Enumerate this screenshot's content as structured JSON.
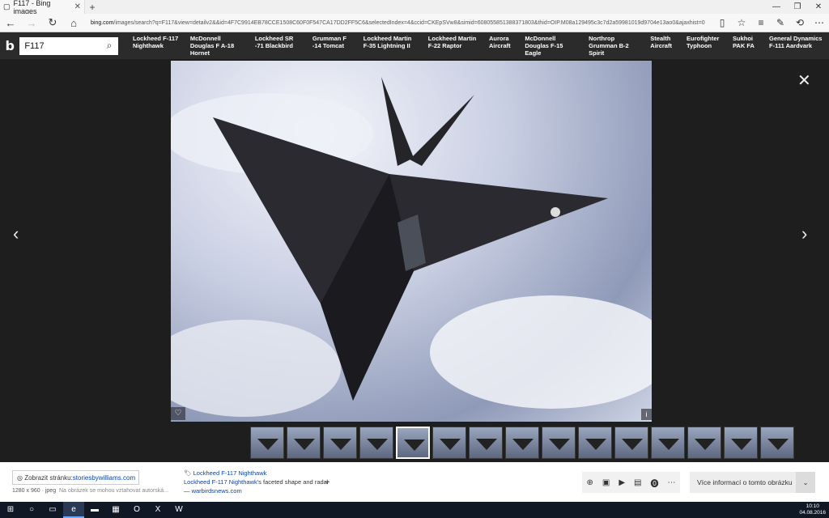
{
  "browser": {
    "tab_title": "F117 - Bing images",
    "url_host": "bing.com",
    "url_rest": "/images/search?q=F117&view=detailv2&&id=4F7C9914EB78CCE1508C60F0F547CA17DD2FF5C6&selectedIndex=4&ccid=CKEpSVw8&simid=608055851388371803&thid=OIP.M08a129495c3c7d2a59981019d9704e13ao0&ajaxhist=0"
  },
  "search": {
    "query": "F117"
  },
  "related": [
    "Lockheed F-117 Nighthawk",
    "McDonnell Douglas F A-18 Hornet",
    "Lockheed SR -71 Blackbird",
    "Grumman F -14 Tomcat",
    "Lockheed Martin F-35 Lightning II",
    "Lockheed Martin F-22 Raptor",
    "Aurora Aircraft",
    "McDonnell Douglas F-15 Eagle",
    "Northrop Grumman B-2 Spirit",
    "Stealth Aircraft",
    "Eurofighter Typhoon",
    "Sukhoi PAK FA",
    "General Dynamics F-111 Aardvark"
  ],
  "details": {
    "visit_label": "Zobrazit stránku:",
    "visit_site": "storiesbywilliams.com",
    "size": "1280 x 960 · jpeg",
    "copyright_note": "Na obrázek se mohou vztahovat autorská...",
    "tag": "Lockheed F-117 Nighthawk",
    "caption_link": "Lockheed F-117 Nighthawk",
    "caption_rest": "'s faceted shape and radar",
    "source": "— warbirdsnews.com",
    "more_info": "Více informací o tomto obrázku"
  },
  "clock": {
    "time": "10:10",
    "date": "04.08.2016"
  },
  "colors": {
    "bing_bar": "#2b2b2b",
    "stage": "#1e1e1e",
    "taskbar": "#101826"
  }
}
